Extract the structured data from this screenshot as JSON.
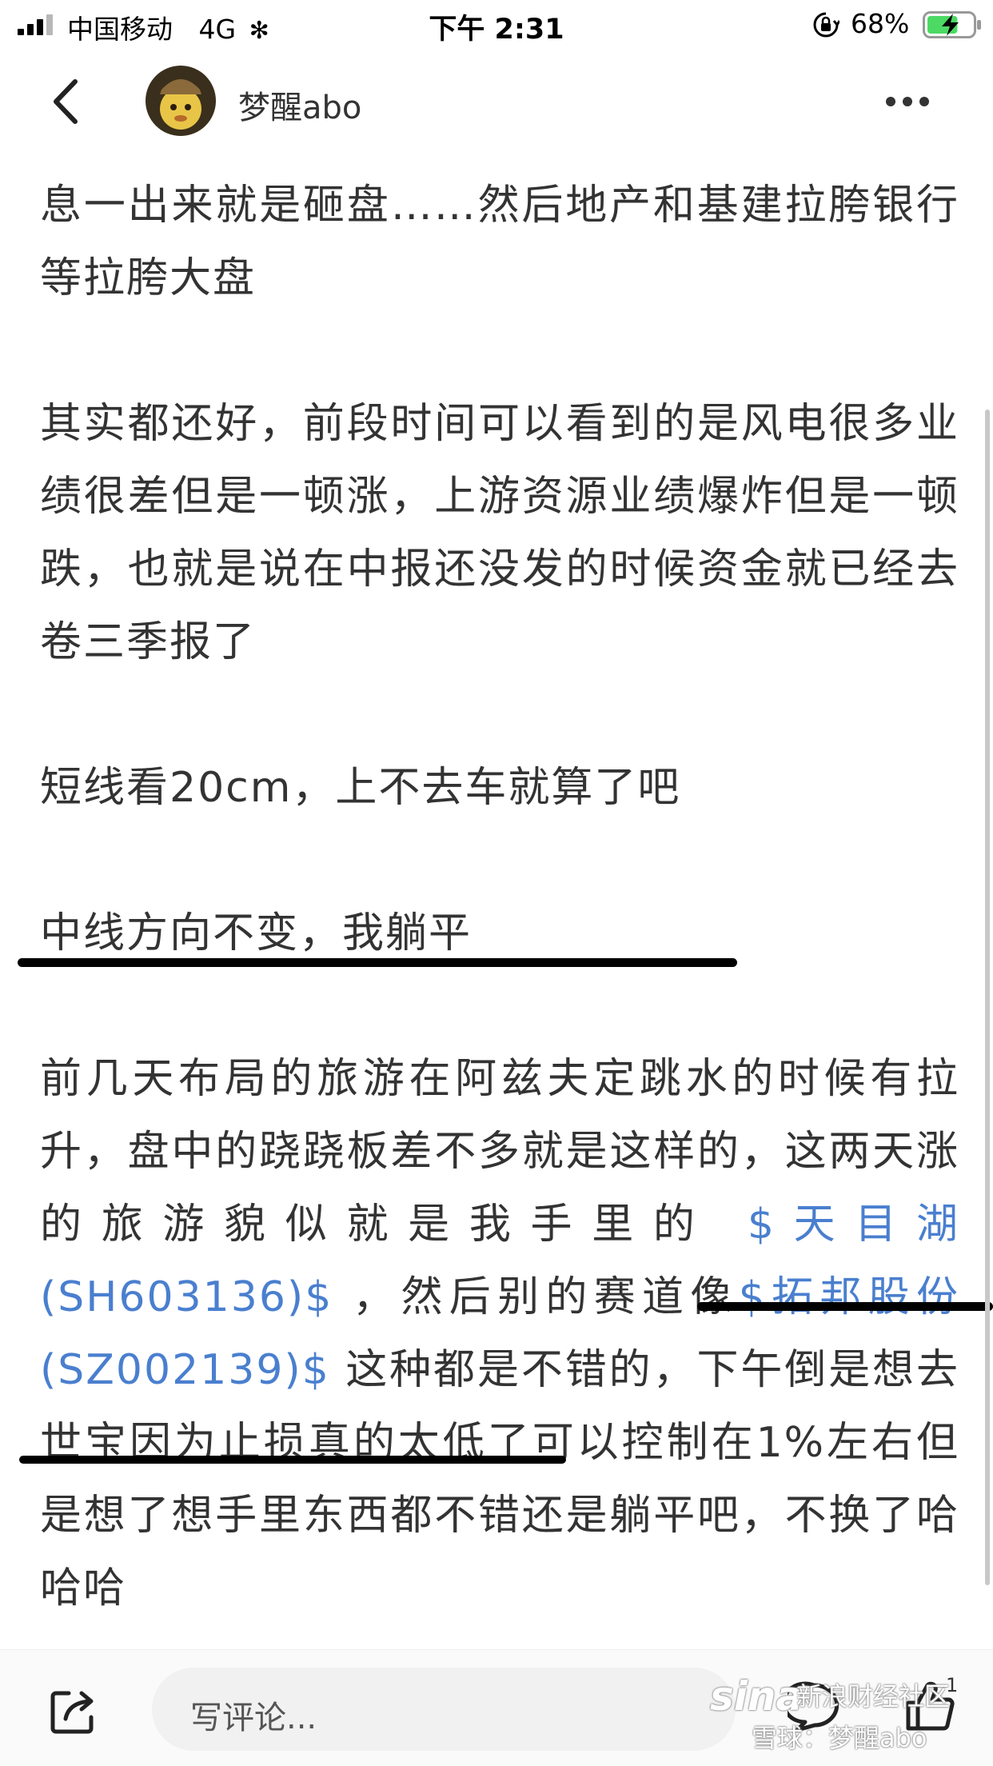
{
  "status_bar": {
    "carrier": "中国移动",
    "network": "4G",
    "time": "下午 2:31",
    "battery_percent": "68%",
    "battery_level": 0.68
  },
  "nav": {
    "author_name": "梦醒abo"
  },
  "article": {
    "paragraphs": [
      "息一出来就是砸盘……然后地产和基建拉胯银行等拉胯大盘",
      "其实都还好，前段时间可以看到的是风电很多业绩很差但是一顿涨，上游资源业绩爆炸但是一顿跌，也就是说在中报还没发的时候资金就已经去卷三季报了",
      "短线看20cm，上不去车就算了吧",
      "中线方向不变，我躺平"
    ],
    "p5": {
      "t1": "前几天布局的旅游在阿兹夫定跳水的时候有拉升，盘中的跷跷板差不多就是这样的，这两天涨的旅游貌似就是我手里的 ",
      "link1": "$天目湖(SH603136)$",
      "t2": " ，然后别的赛道像",
      "link2": "$拓邦股份(SZ002139)$",
      "t3": " 这种都是不错的，下午倒是想去世宝因为止损真的太低了可以控制在1%左右但是想了想手里东西都不错还是躺平吧，不换了哈哈哈"
    }
  },
  "bottom_bar": {
    "comment_placeholder": "写评论...",
    "like_count": "1"
  },
  "watermark": {
    "logo": "sina",
    "line1": "新浪财经社区",
    "line2": "雪球：梦醒abo"
  },
  "colors": {
    "link": "#4a7fcf",
    "text": "#333333",
    "battery_green": "#4cd964"
  }
}
